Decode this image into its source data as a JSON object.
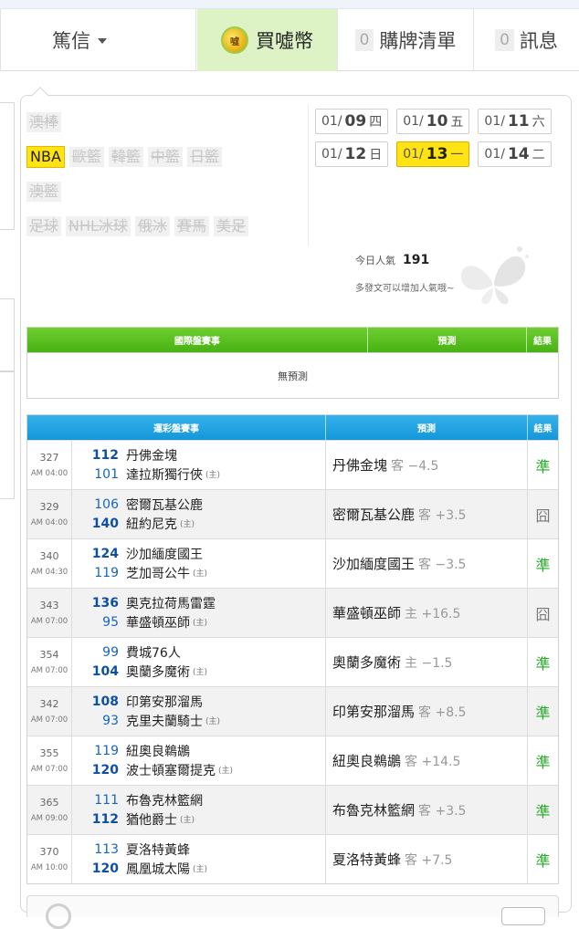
{
  "nav": {
    "messages_label": "篤信",
    "buy_label": "買噓幣",
    "coin_glyph": "噓",
    "list_count": "0",
    "list_label": "購牌清單",
    "news_count": "0",
    "news_label": "訊息"
  },
  "sports": {
    "row1": [
      "澳棒"
    ],
    "row2": [
      "NBA",
      "歐籃",
      "韓籃",
      "中籃",
      "日籃"
    ],
    "row3": [
      "澳籃"
    ],
    "row4": [
      "足球",
      "NHL冰球",
      "俄冰",
      "賽馬",
      "美足"
    ],
    "active": "NBA"
  },
  "dates": [
    {
      "month": "01/",
      "day": "09",
      "weekday": "四"
    },
    {
      "month": "01/",
      "day": "10",
      "weekday": "五"
    },
    {
      "month": "01/",
      "day": "11",
      "weekday": "六"
    },
    {
      "month": "01/",
      "day": "12",
      "weekday": "日"
    },
    {
      "month": "01/",
      "day": "13",
      "weekday": "一"
    },
    {
      "month": "01/",
      "day": "14",
      "weekday": "二"
    }
  ],
  "popularity": {
    "label": "今日人氣",
    "value": "191",
    "hint": "多發文可以增加人氣哦~"
  },
  "intl_table": {
    "col_game": "國際盤賽事",
    "col_pred": "預測",
    "col_result": "結果",
    "empty_text": "無預測"
  },
  "lottery_table": {
    "col_game": "運彩盤賽事",
    "col_pred": "預測",
    "col_result": "結果",
    "rows": [
      {
        "no": "327",
        "time": "AM 04:00",
        "away_score": "112",
        "away": "丹佛金塊",
        "home_score": "101",
        "home": "達拉斯獨行俠",
        "pred": "丹佛金塊",
        "side": "客 −4.5",
        "result": "準",
        "win_top": true
      },
      {
        "no": "329",
        "time": "AM 04:00",
        "away_score": "106",
        "away": "密爾瓦基公鹿",
        "home_score": "140",
        "home": "紐約尼克",
        "pred": "密爾瓦基公鹿",
        "side": "客 +3.5",
        "result": "囧",
        "win_top": false
      },
      {
        "no": "340",
        "time": "AM 04:30",
        "away_score": "124",
        "away": "沙加緬度國王",
        "home_score": "119",
        "home": "芝加哥公牛",
        "pred": "沙加緬度國王",
        "side": "客 −3.5",
        "result": "準",
        "win_top": true
      },
      {
        "no": "343",
        "time": "AM 07:00",
        "away_score": "136",
        "away": "奧克拉荷馬雷霆",
        "home_score": "95",
        "home": "華盛頓巫師",
        "pred": "華盛頓巫師",
        "side": "主 +16.5",
        "result": "囧",
        "win_top": true
      },
      {
        "no": "354",
        "time": "AM 07:00",
        "away_score": "99",
        "away": "費城76人",
        "home_score": "104",
        "home": "奧蘭多魔術",
        "pred": "奧蘭多魔術",
        "side": "主 −1.5",
        "result": "準",
        "win_top": false
      },
      {
        "no": "342",
        "time": "AM 07:00",
        "away_score": "108",
        "away": "印第安那溜馬",
        "home_score": "93",
        "home": "克里夫蘭騎士",
        "pred": "印第安那溜馬",
        "side": "客 +8.5",
        "result": "準",
        "win_top": true
      },
      {
        "no": "355",
        "time": "AM 07:00",
        "away_score": "119",
        "away": "紐奧良鵜鶘",
        "home_score": "120",
        "home": "波士頓塞爾提克",
        "pred": "紐奧良鵜鶘",
        "side": "客 +14.5",
        "result": "準",
        "win_top": false
      },
      {
        "no": "365",
        "time": "AM 09:00",
        "away_score": "111",
        "away": "布魯克林籃網",
        "home_score": "112",
        "home": "猶他爵士",
        "pred": "布魯克林籃網",
        "side": "客 +3.5",
        "result": "準",
        "win_top": false
      },
      {
        "no": "370",
        "time": "AM 10:00",
        "away_score": "113",
        "away": "夏洛特黃蜂",
        "home_score": "120",
        "home": "鳳凰城太陽",
        "pred": "夏洛特黃蜂",
        "side": "客 +7.5",
        "result": "準",
        "win_top": false
      }
    ],
    "home_marker": "(主)"
  }
}
